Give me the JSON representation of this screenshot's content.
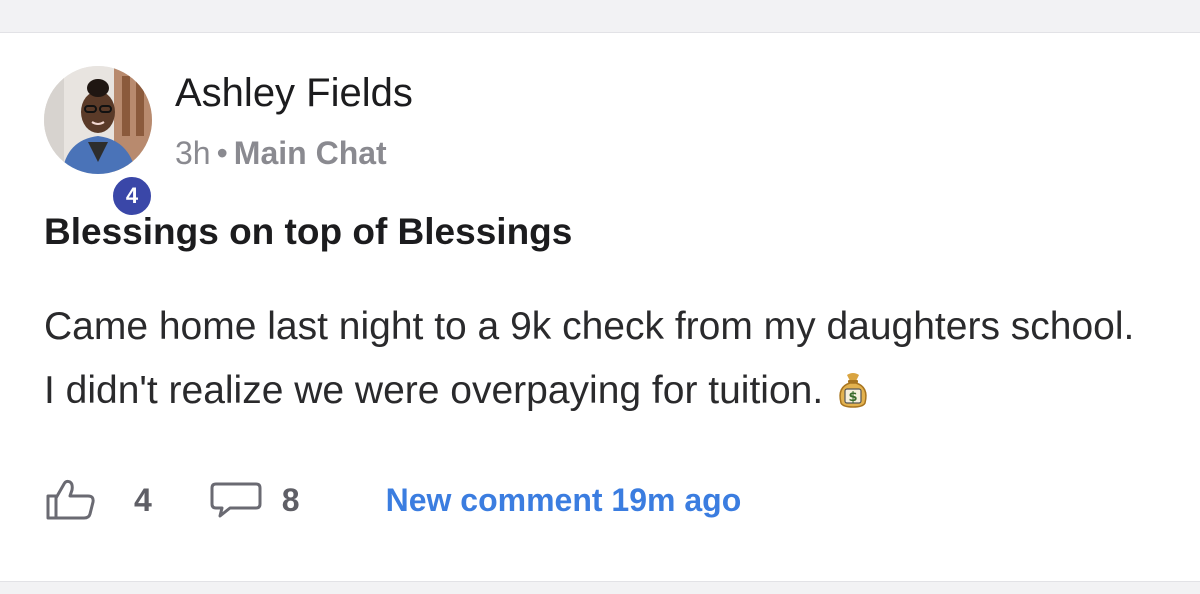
{
  "post": {
    "author": {
      "name": "Ashley Fields",
      "level_badge": "4"
    },
    "time": "3h",
    "separator": "•",
    "channel": "Main Chat",
    "title": "Blessings on top of Blessings",
    "body": "Came home last night to a 9k check from my daughters school. I didn't realize we were overpaying for tuition.",
    "body_emoji_icon": "money-bag-icon"
  },
  "actions": {
    "like_icon": "thumbs-up-icon",
    "like_count": "4",
    "comment_icon": "comment-bubble-icon",
    "comment_count": "8",
    "new_comment_link": "New comment 19m ago"
  },
  "colors": {
    "badge": "#3a47a8",
    "link": "#3b7de0",
    "meta_text": "#8a8a90"
  }
}
